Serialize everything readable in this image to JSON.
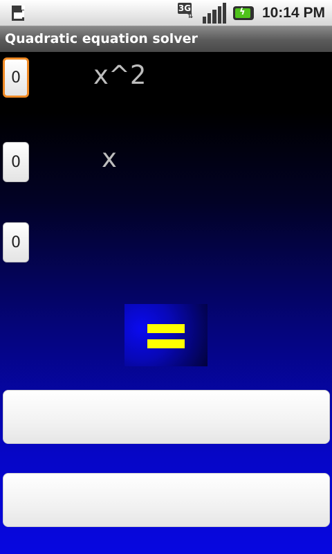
{
  "status_bar": {
    "network": "3G",
    "time": "10:14 PM"
  },
  "app": {
    "title": "Quadratic equation solver"
  },
  "equation": {
    "a_value": "0",
    "b_value": "0",
    "c_value": "0",
    "a_term": "x^2",
    "b_term": "x"
  },
  "results": {
    "root1": "",
    "root2": ""
  },
  "colors": {
    "focus_border": "#f08a24",
    "equals_glyph": "#ffff00",
    "background_bottom": "#0707e0"
  }
}
